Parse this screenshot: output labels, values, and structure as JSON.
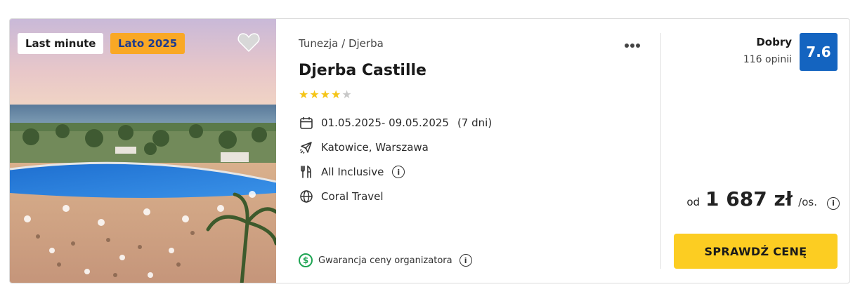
{
  "badges": {
    "last_minute": "Last minute",
    "season": "Lato 2025"
  },
  "hotel": {
    "breadcrumb": "Tunezja / Djerba",
    "name": "Djerba Castille",
    "stars_filled": 4,
    "stars_total": 5,
    "dates": "01.05.2025- 09.05.2025",
    "duration": "(7 dni)",
    "departure": "Katowice, Warszawa",
    "board": "All Inclusive",
    "operator": "Coral Travel",
    "guarantee": "Gwarancja ceny organizatora"
  },
  "rating": {
    "label": "Dobry",
    "reviews": "116 opinii",
    "score": "7.6"
  },
  "price": {
    "prefix": "od",
    "amount": "1 687 zł",
    "suffix": "/os."
  },
  "cta": {
    "label": "SPRAWDŹ CENĘ"
  },
  "icons": {
    "favorite": "heart-icon",
    "more": "more-dots-icon",
    "dates": "calendar-icon",
    "departure": "plane-icon",
    "board": "cutlery-icon",
    "operator": "globe-icon",
    "info": "info-icon",
    "guarantee": "dollar-circle-icon"
  },
  "colors": {
    "score_bg": "#1464c0",
    "cta_bg": "#fccd22",
    "season_badge_bg": "#f9a825",
    "star": "#f5c518",
    "guarantee": "#1ea453"
  }
}
